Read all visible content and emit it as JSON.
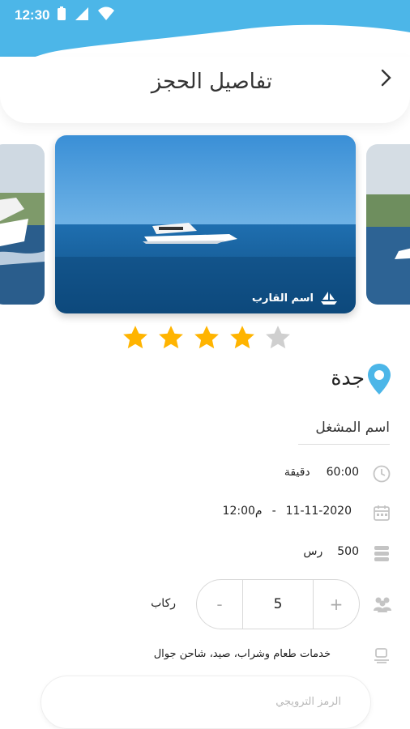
{
  "status_bar": {
    "time": "12:30"
  },
  "header": {
    "title": "تفاصيل الحجز"
  },
  "boat": {
    "name": "اسم القارب",
    "rating": 4,
    "max_rating": 5
  },
  "location": {
    "city": "جدة"
  },
  "operator": {
    "name": "اسم المشغل"
  },
  "details": {
    "duration_value": "60:00",
    "duration_unit": "دقيقة",
    "date": "11-11-2020",
    "separator": "-",
    "time": "12:00م",
    "price_value": "500",
    "price_unit": "رس",
    "passengers_label": "ركاب",
    "services": "خدمات طعام وشراب، صيد، شاحن جوال"
  },
  "stepper": {
    "value": "5",
    "minus": "-",
    "plus": "+"
  },
  "promo": {
    "placeholder": "الرمز الترويجي"
  },
  "colors": {
    "accent": "#4cb6e8",
    "star": "#ffb400",
    "star_empty": "#cfcfcf"
  }
}
